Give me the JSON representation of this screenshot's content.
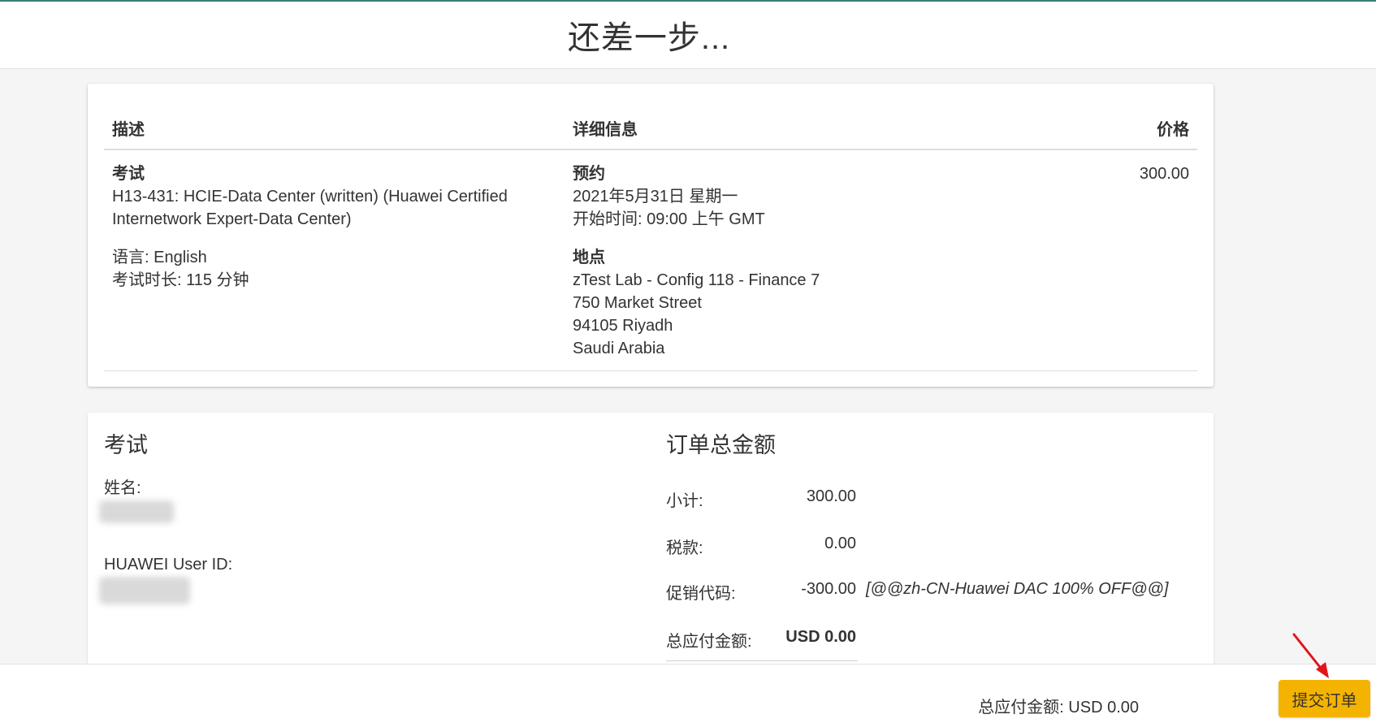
{
  "page": {
    "title": "还差一步..."
  },
  "order_table": {
    "headers": {
      "description": "描述",
      "details": "详细信息",
      "price": "价格"
    },
    "row": {
      "exam_label": "考试",
      "exam_name_line1": "H13-431: HCIE-Data Center (written) (Huawei Certified",
      "exam_name_line2": "Internetwork Expert-Data Center)",
      "language": "语言: English",
      "duration": "考试时长: 115 分钟",
      "appointment_label": "预约",
      "date": "2021年5月31日 星期一",
      "start_time": "开始时间:  09:00 上午 GMT",
      "location_label": "地点",
      "location_name": "zTest Lab - Config 118 - Finance 7",
      "street": "750 Market Street",
      "city": "94105 Riyadh",
      "country": "Saudi Arabia",
      "price": "300.00"
    }
  },
  "candidate": {
    "section_title": "考试",
    "name_label": "姓名:",
    "user_id_label": "HUAWEI User ID:"
  },
  "order_total": {
    "section_title": "订单总金额",
    "subtotal_label": "小计:",
    "subtotal_value": "300.00",
    "tax_label": "税款:",
    "tax_value": "0.00",
    "promo_label": "促销代码:",
    "promo_value": "-300.00",
    "promo_code": "[@@zh-CN-Huawei DAC 100% OFF@@]",
    "total_label": "总应付金额:",
    "total_value": "USD 0.00"
  },
  "footer": {
    "total_text": "总应付金额: USD 0.00",
    "submit_label": "提交订单"
  },
  "colors": {
    "accent_button": "#f5b301",
    "annotation_arrow": "#e0161b",
    "top_line": "#3b7f72"
  }
}
